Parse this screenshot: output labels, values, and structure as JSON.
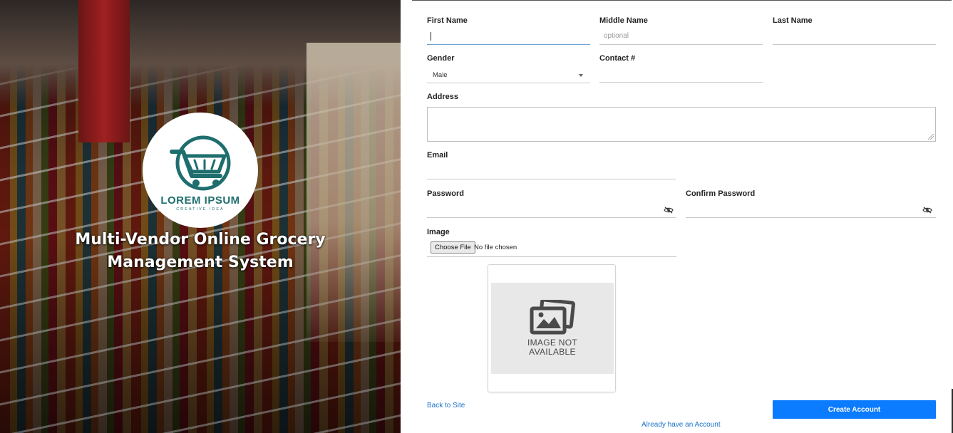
{
  "hero": {
    "logo_name": "LOREM IPSUM",
    "logo_tagline": "CREATIVE IDEA",
    "title": "Multi-Vendor Online Grocery Management System"
  },
  "form": {
    "first_name": {
      "label": "First Name",
      "value": ""
    },
    "middle_name": {
      "label": "Middle Name",
      "placeholder": "optional"
    },
    "last_name": {
      "label": "Last Name",
      "value": ""
    },
    "gender": {
      "label": "Gender",
      "selected": "Male"
    },
    "contact": {
      "label": "Contact #",
      "value": ""
    },
    "address": {
      "label": "Address",
      "value": ""
    },
    "email": {
      "label": "Email",
      "value": ""
    },
    "password": {
      "label": "Password",
      "value": ""
    },
    "confirm_password": {
      "label": "Confirm Password",
      "value": ""
    },
    "image": {
      "label": "Image",
      "button_label": "Choose File",
      "status": "No file chosen",
      "preview_text_line1": "IMAGE NOT",
      "preview_text_line2": "AVAILABLE"
    },
    "back_link": "Back to Site",
    "submit_label": "Create Account",
    "login_link": "Already have an Account"
  },
  "colors": {
    "accent": "#0b7bff",
    "link": "#1a73c8",
    "logo": "#1f6e6e"
  },
  "icons": {
    "password_toggle": "eye-slash-icon",
    "preview_placeholder": "image-placeholder-icon",
    "logo": "shopping-cart-icon"
  }
}
